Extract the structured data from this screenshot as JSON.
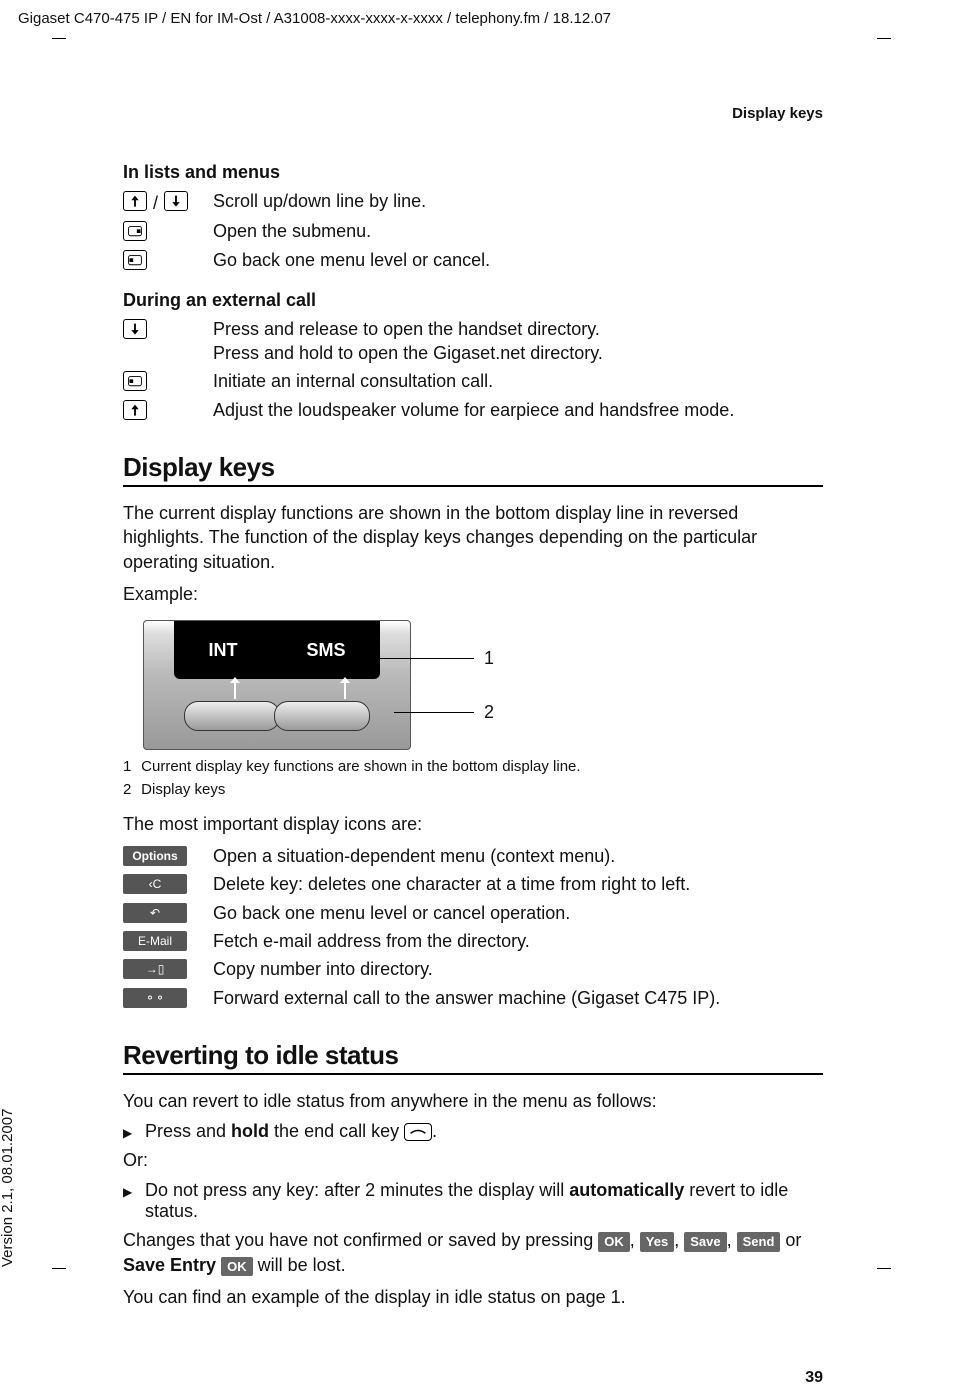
{
  "header_path": "Gigaset C470-475 IP / EN for IM-Ost / A31008-xxxx-xxxx-x-xxxx / telephony.fm / 18.12.07",
  "version_sidebar": "Version 2.1, 08.01.2007",
  "top_right_label": "Display keys",
  "lists_menus": {
    "heading": "In lists and menus",
    "rows": [
      {
        "text": "Scroll up/down line by line."
      },
      {
        "text": "Open the submenu."
      },
      {
        "text": "Go back one menu level or cancel."
      }
    ]
  },
  "external_call": {
    "heading": "During an external call",
    "rows": [
      {
        "text": "Press and release to open the handset directory.\nPress and hold to open the Gigaset.net directory."
      },
      {
        "text": "Initiate an internal consultation call."
      },
      {
        "text": "Adjust the loudspeaker volume for earpiece and handsfree mode."
      }
    ]
  },
  "display_keys": {
    "title": "Display keys",
    "intro": "The current display functions are shown in the bottom display line in reversed highlights. The function of the display keys changes depending on the particular operating situation.",
    "example_label": "Example:",
    "fig_labels": {
      "int": "INT",
      "sms": "SMS",
      "n1": "1",
      "n2": "2"
    },
    "caption1_num": "1",
    "caption1": "Current display key functions are shown in the bottom display line.",
    "caption2_num": "2",
    "caption2": "Display keys",
    "icons_intro": "The most important display icons are:",
    "icon_rows": [
      {
        "label": "Options",
        "text": "Open a situation-dependent menu (context menu)."
      },
      {
        "label": "delete-c",
        "text": "Delete key: deletes one character at a time from right to left."
      },
      {
        "label": "back-arrow",
        "text": "Go back one menu level or cancel operation."
      },
      {
        "label": "E-Mail",
        "text": "Fetch e-mail address from the directory."
      },
      {
        "label": "copy-dir",
        "text": "Copy number into directory."
      },
      {
        "label": "tape",
        "text": "Forward external call to the answer machine (Gigaset C475 IP)."
      }
    ]
  },
  "idle": {
    "title": "Reverting to idle status",
    "intro": "You can revert to idle status from anywhere in the menu as follows:",
    "bullet1a": "Press and ",
    "bullet1_hold": "hold",
    "bullet1b": " the end call key ",
    "bullet1c": ".",
    "or": "Or:",
    "bullet2a": "Do not press any key: after 2 minutes the display will ",
    "bullet2_auto": "automatically",
    "bullet2b": " revert to idle status.",
    "not_saved_a": "Changes that you have not confirmed or saved by pressing ",
    "k_ok": "OK",
    "sep": ", ",
    "k_yes": "Yes",
    "k_save": "Save",
    "k_send": "Send",
    "not_saved_b": " or ",
    "k_save_entry": "Save Entry",
    "not_saved_c": " will be lost.",
    "closing": "You can find an example of the display in idle status on page 1."
  },
  "page_number": "39"
}
